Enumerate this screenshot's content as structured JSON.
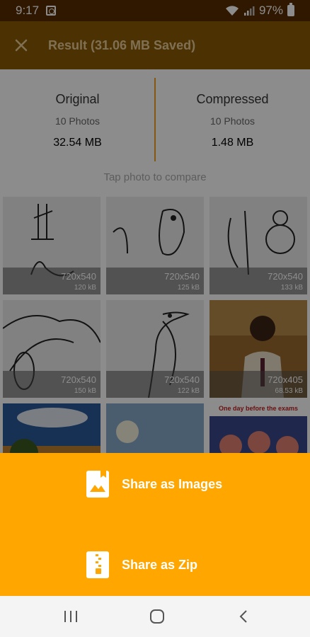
{
  "status": {
    "time": "9:17",
    "battery": "97%"
  },
  "appbar": {
    "title": "Result (31.06 MB Saved)"
  },
  "summary": {
    "original": {
      "label": "Original",
      "count": "10 Photos",
      "size": "32.54 MB"
    },
    "compressed": {
      "label": "Compressed",
      "count": "10 Photos",
      "size": "1.48 MB"
    }
  },
  "hint": "Tap photo to compare",
  "photos": [
    {
      "res": "720x540",
      "size": "120 kB"
    },
    {
      "res": "720x540",
      "size": "125 kB"
    },
    {
      "res": "720x540",
      "size": "133 kB"
    },
    {
      "res": "720x540",
      "size": "150 kB"
    },
    {
      "res": "720x540",
      "size": "122 kB"
    },
    {
      "res": "720x405",
      "size": "68.53 kB"
    },
    {
      "res": "",
      "size": ""
    },
    {
      "res": "",
      "size": ""
    },
    {
      "res": "",
      "size": ""
    }
  ],
  "meme_caption": "One day before the exams",
  "sheet": {
    "share_images": "Share as Images",
    "share_zip": "Share as Zip"
  },
  "colors": {
    "accent": "#ffa600",
    "appbar": "#8a5a04",
    "statusbar": "#582c00"
  },
  "icons": [
    "close-icon",
    "image-icon",
    "zip-icon",
    "recent-apps-icon",
    "home-icon",
    "back-icon"
  ]
}
